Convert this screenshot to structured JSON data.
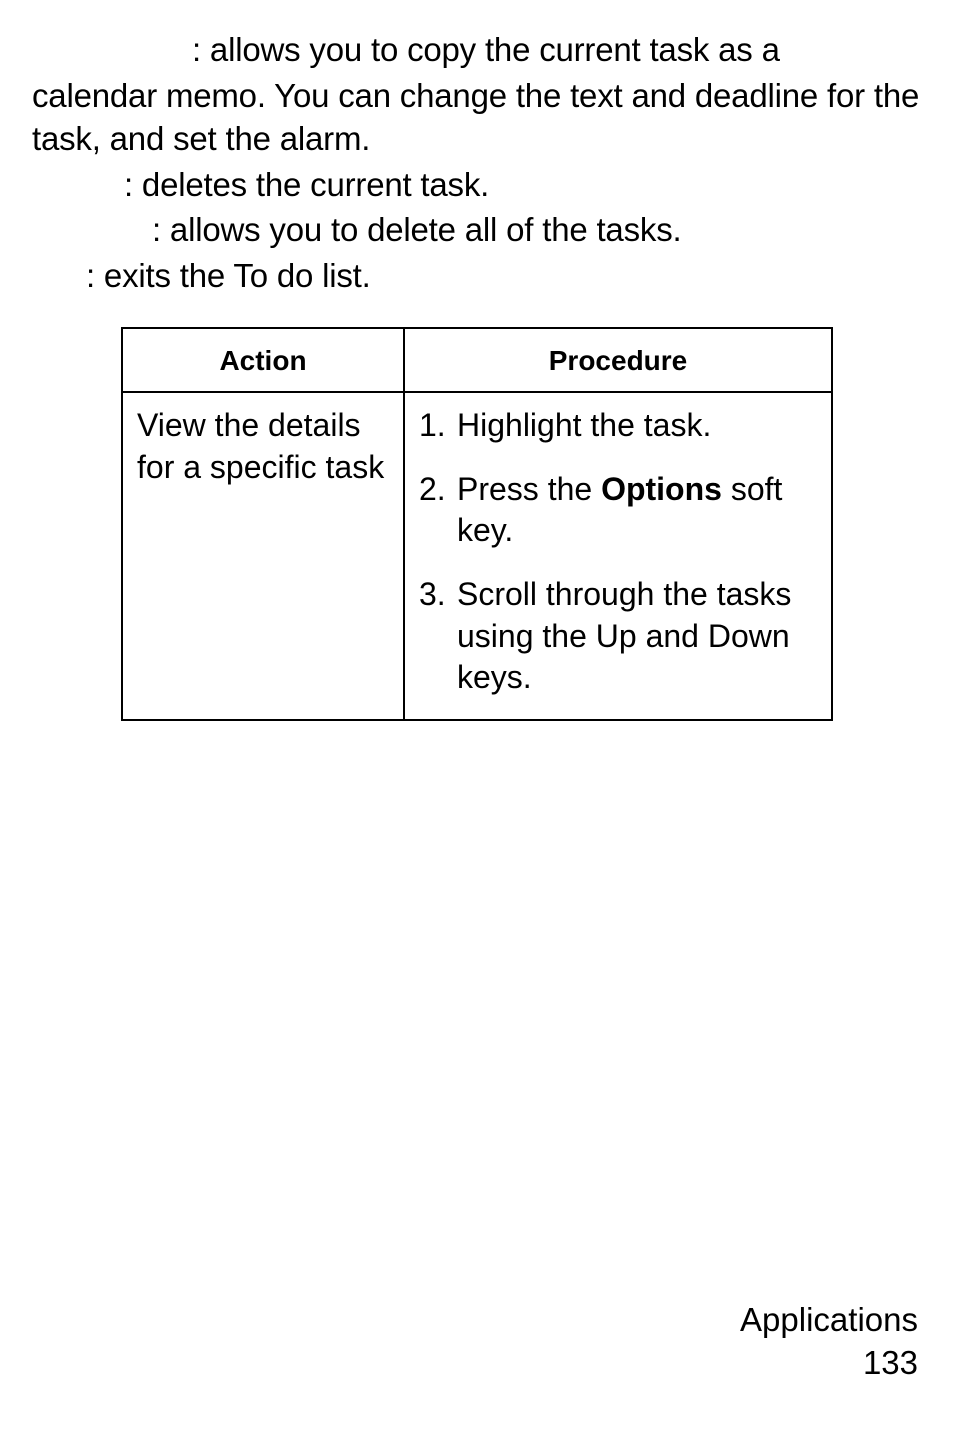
{
  "para1_lead": ": allows you to copy the current task as a",
  "para1_cont": "calendar memo. You can change the text and deadline for the task, and set the alarm.",
  "para2": ": deletes the current task.",
  "para3": ": allows you to delete all of the tasks.",
  "para4": ": exits the To do list.",
  "table": {
    "headers": {
      "action": "Action",
      "procedure": "Procedure"
    },
    "row": {
      "action": "View the details for a specific task",
      "steps": {
        "s1_num": "1.",
        "s1_text": "Highlight the task.",
        "s2_num": "2.",
        "s2_pre": "Press the ",
        "s2_bold": "Options",
        "s2_post": " soft key.",
        "s3_num": "3.",
        "s3_text": "Scroll through the tasks using the Up and Down keys."
      }
    }
  },
  "footer": {
    "section": "Applications",
    "page": "133"
  }
}
